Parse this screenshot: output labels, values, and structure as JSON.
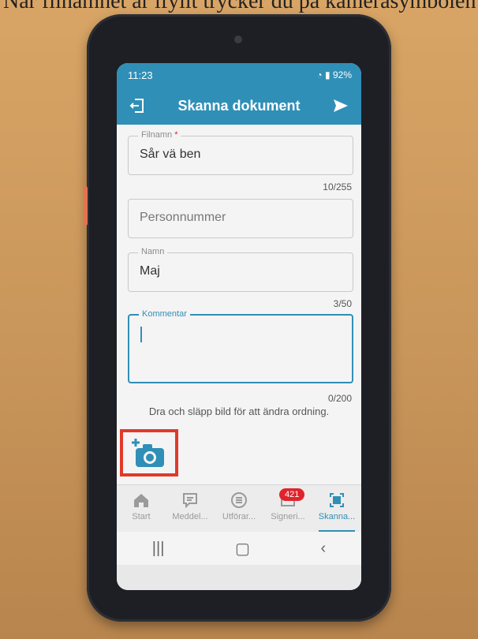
{
  "caption": "När filnamnet är ifyllt trycker du på kamerasymbolen",
  "status": {
    "time": "11:23",
    "battery": "92%"
  },
  "appbar": {
    "title": "Skanna dokument"
  },
  "form": {
    "filename": {
      "label": "Filnamn",
      "required_mark": "*",
      "value": "Sår vä ben",
      "counter": "10/255"
    },
    "personnummer": {
      "placeholder": "Personnummer"
    },
    "namn": {
      "label": "Namn",
      "value": "Maj",
      "counter": "3/50"
    },
    "kommentar": {
      "label": "Kommentar",
      "value": "",
      "counter": "0/200"
    },
    "hint": "Dra och släpp bild för att ändra ordning."
  },
  "nav": {
    "items": [
      {
        "label": "Start",
        "icon": "home-icon"
      },
      {
        "label": "Meddel...",
        "icon": "message-icon"
      },
      {
        "label": "Utförar...",
        "icon": "list-icon"
      },
      {
        "label": "Signeri...",
        "icon": "signature-icon",
        "badge": "421"
      },
      {
        "label": "Skanna...",
        "icon": "scan-icon",
        "active": true
      }
    ]
  },
  "colors": {
    "accent": "#2f8fb7",
    "highlight": "#e03a2a",
    "badge": "#e0242c"
  }
}
